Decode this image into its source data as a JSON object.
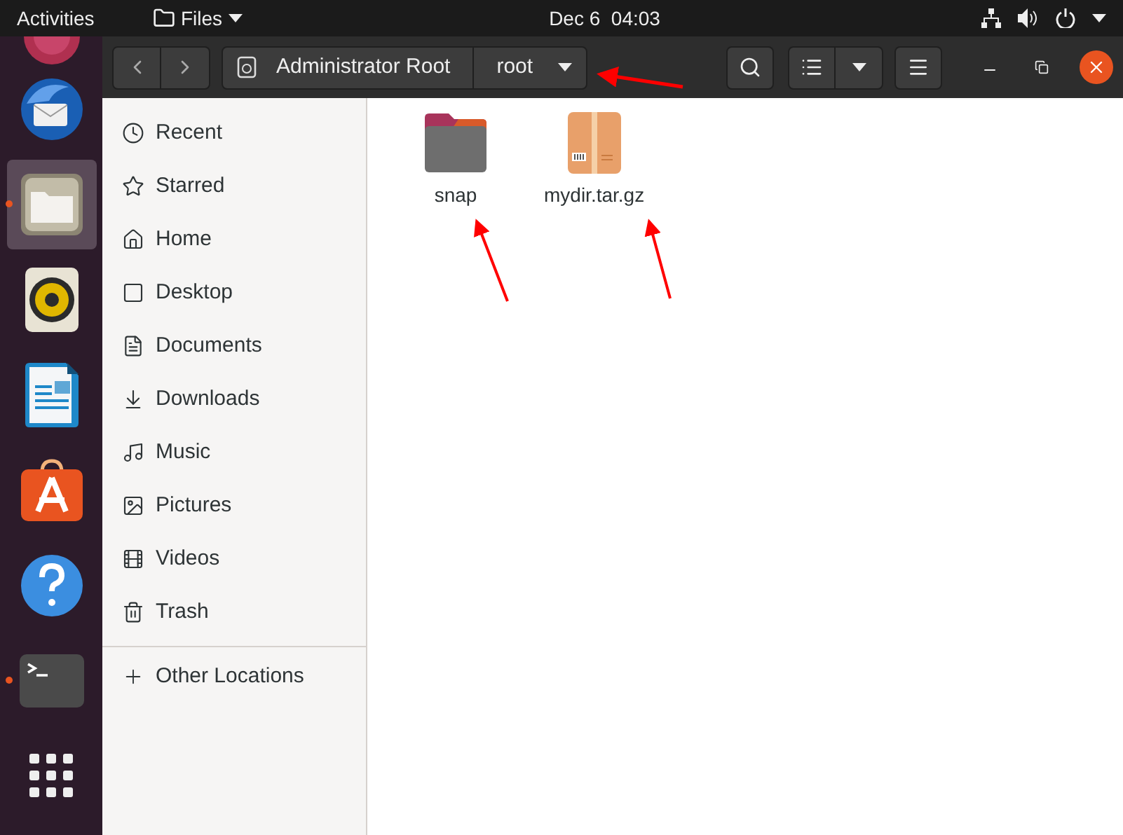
{
  "top_bar": {
    "activities": "Activities",
    "app_menu": "Files",
    "clock": "Dec 6  04:03"
  },
  "dock": [
    {
      "kind": "mail",
      "running": false,
      "selected": false
    },
    {
      "kind": "files",
      "running": true,
      "selected": true
    },
    {
      "kind": "speaker",
      "running": false,
      "selected": false
    },
    {
      "kind": "writer",
      "running": false,
      "selected": false
    },
    {
      "kind": "store",
      "running": false,
      "selected": false
    },
    {
      "kind": "help",
      "running": false,
      "selected": false
    },
    {
      "kind": "terminal",
      "running": true,
      "selected": false
    },
    {
      "kind": "grid",
      "running": false,
      "selected": false
    }
  ],
  "path_bar": [
    {
      "label": "Administrator Root",
      "kind": "drive"
    },
    {
      "label": "root",
      "kind": "folder"
    }
  ],
  "sidebar": {
    "items": [
      {
        "label": "Recent",
        "kind": "clock"
      },
      {
        "label": "Starred",
        "kind": "star"
      },
      {
        "label": "Home",
        "kind": "home"
      },
      {
        "label": "Desktop",
        "kind": "desktop"
      },
      {
        "label": "Documents",
        "kind": "document"
      },
      {
        "label": "Downloads",
        "kind": "download"
      },
      {
        "label": "Music",
        "kind": "music"
      },
      {
        "label": "Pictures",
        "kind": "image"
      },
      {
        "label": "Videos",
        "kind": "film"
      },
      {
        "label": "Trash",
        "kind": "trash"
      }
    ],
    "other": {
      "label": "Other Locations",
      "kind": "plus"
    }
  },
  "files": [
    {
      "name": "snap",
      "kind": "folder"
    },
    {
      "name": "mydir.tar.gz",
      "kind": "archive"
    }
  ]
}
